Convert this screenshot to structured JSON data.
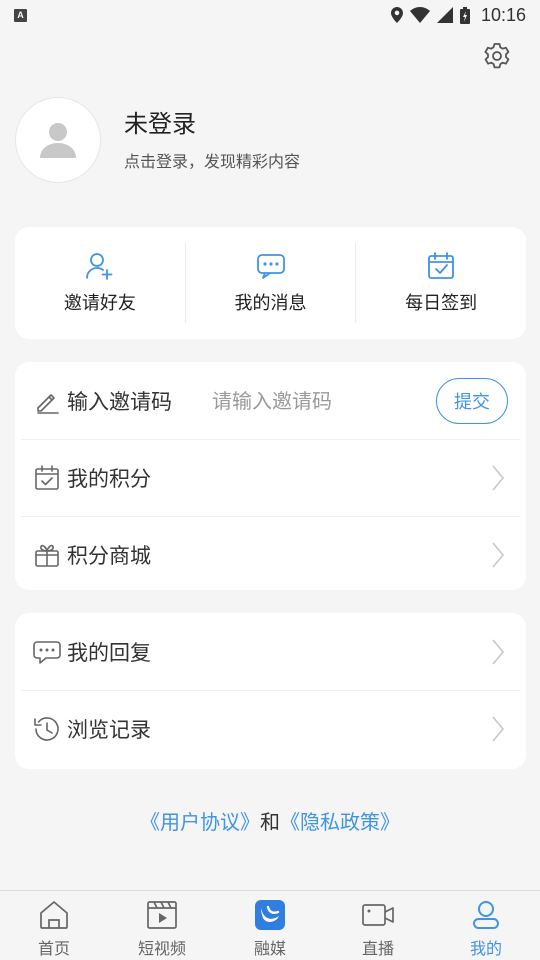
{
  "status_bar": {
    "left_icon_letter": "A",
    "time": "10:16",
    "icons": [
      "location-icon",
      "wifi-icon",
      "signal-icon",
      "battery-icon"
    ]
  },
  "header": {
    "settings_icon": "gear-icon"
  },
  "profile": {
    "name": "未登录",
    "subtitle": "点击登录，发现精彩内容",
    "avatar_icon": "user-avatar-icon"
  },
  "quick_actions": [
    {
      "label": "邀请好友",
      "icon": "add-user-icon"
    },
    {
      "label": "我的消息",
      "icon": "message-icon"
    },
    {
      "label": "每日签到",
      "icon": "calendar-check-icon"
    }
  ],
  "invite": {
    "label": "输入邀请码",
    "placeholder": "请输入邀请码",
    "value": "",
    "submit_label": "提交",
    "icon": "pencil-icon"
  },
  "menu1": [
    {
      "label": "我的积分",
      "icon": "calendar-check-icon"
    },
    {
      "label": "积分商城",
      "icon": "gift-icon"
    }
  ],
  "menu2": [
    {
      "label": "我的回复",
      "icon": "comment-icon"
    },
    {
      "label": "浏览记录",
      "icon": "history-icon"
    }
  ],
  "agreement": {
    "user_agreement": "《用户协议》",
    "conjunction": "和",
    "privacy_policy": "《隐私政策》"
  },
  "bottom_nav": {
    "active_index": 4,
    "items": [
      {
        "label": "首页",
        "icon": "home-icon"
      },
      {
        "label": "短视频",
        "icon": "video-clip-icon"
      },
      {
        "label": "融媒",
        "icon": "media-logo-icon"
      },
      {
        "label": "直播",
        "icon": "camera-icon"
      },
      {
        "label": "我的",
        "icon": "user-icon"
      }
    ]
  },
  "colors": {
    "accent": "#3f94e4",
    "background": "#f5f5f5",
    "card": "#ffffff",
    "text": "#333333"
  }
}
